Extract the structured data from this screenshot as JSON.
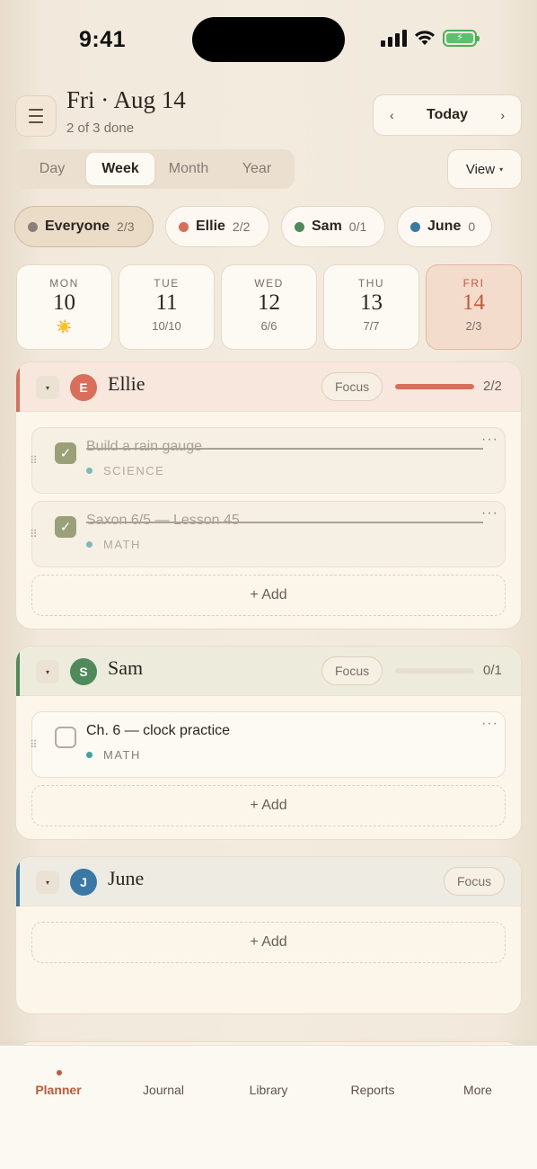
{
  "status": {
    "time": "9:41",
    "battery_symbol": "⚡"
  },
  "header": {
    "date_title": "Fri · Aug 14",
    "done_summary": "2 of 3 done",
    "prev_symbol": "‹",
    "next_symbol": "›",
    "today_label": "Today"
  },
  "view_tabs": [
    "Day",
    "Week",
    "Month",
    "Year"
  ],
  "view_tabs_active": "Week",
  "view_button": {
    "label": "View",
    "caret": "▾"
  },
  "filters": [
    {
      "name": "Everyone",
      "count": "2/3",
      "color": "#8a8077",
      "active": true
    },
    {
      "name": "Ellie",
      "count": "2/2",
      "color": "#d96e5a",
      "active": false
    },
    {
      "name": "Sam",
      "count": "0/1",
      "color": "#4e8a5a",
      "active": false
    },
    {
      "name": "June",
      "count": "0",
      "color": "#3a78a6",
      "active": false
    }
  ],
  "week": [
    {
      "dname": "MON",
      "dnum": "10",
      "dsub": "☀️"
    },
    {
      "dname": "TUE",
      "dnum": "11",
      "dsub": "10/10"
    },
    {
      "dname": "WED",
      "dnum": "12",
      "dsub": "6/6"
    },
    {
      "dname": "THU",
      "dnum": "13",
      "dsub": "7/7"
    },
    {
      "dname": "FRI",
      "dnum": "14",
      "dsub": "2/3",
      "today": true
    }
  ],
  "kids": [
    {
      "initial": "E",
      "name": "Ellie",
      "color": "#d96e5a",
      "head_bg": "#f8e7dc",
      "focus_label": "Focus",
      "progress": 1.0,
      "count": "2/2",
      "progress_color": "#d96e5a",
      "tasks": [
        {
          "title": "Build a rain gauge",
          "subject": "SCIENCE",
          "subject_color": "#7fb8b8",
          "done": true
        },
        {
          "title": "Saxon 6/5 — Lesson 45",
          "subject": "MATH",
          "subject_color": "#7fb8b8",
          "done": true
        }
      ],
      "add_label": "+ Add"
    },
    {
      "initial": "S",
      "name": "Sam",
      "color": "#4e8a5a",
      "head_bg": "#ecebdc",
      "focus_label": "Focus",
      "progress": 0.0,
      "count": "0/1",
      "progress_color": "#4e8a5a",
      "tasks": [
        {
          "title": "Ch. 6 — clock practice",
          "subject": "MATH",
          "subject_color": "#3aa3a0",
          "done": false
        }
      ],
      "add_label": "+ Add"
    },
    {
      "initial": "J",
      "name": "June",
      "color": "#3a78a6",
      "head_bg": "#eeebe3",
      "focus_label": "Focus",
      "count": "",
      "tasks": [],
      "add_label": "+ Add"
    }
  ],
  "symbols": {
    "collapse": "▾",
    "check": "✓",
    "grip": "⠿",
    "more": "···"
  },
  "tabbar": [
    "Planner",
    "Journal",
    "Library",
    "Reports",
    "More"
  ],
  "tabbar_active": "Planner"
}
